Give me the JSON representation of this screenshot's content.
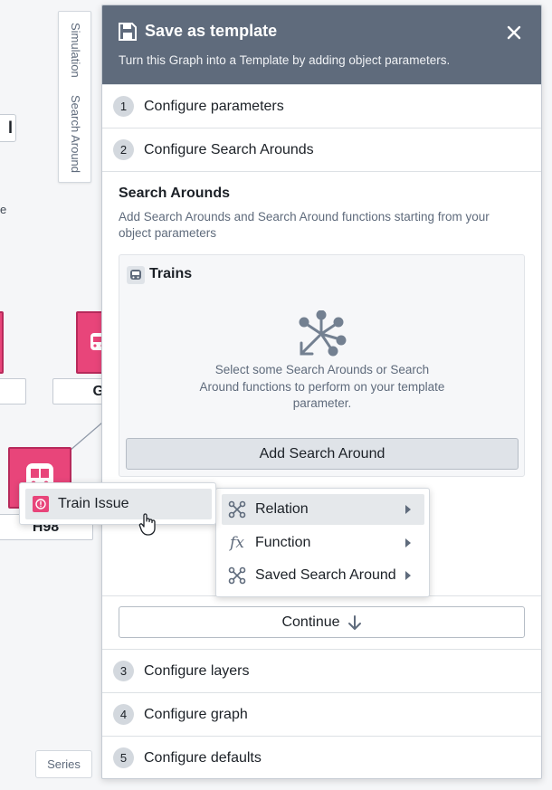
{
  "canvas": {
    "vertical_tabs": [
      "Simulation",
      "Search Around"
    ],
    "clipped_chip_text": "l",
    "clipped_text": "e",
    "node_labels": [
      "G",
      "H98"
    ],
    "series_button": "Series"
  },
  "panel": {
    "title": "Save as template",
    "subtitle": "Turn this Graph into a Template by adding object parameters.",
    "steps": [
      {
        "num": "1",
        "label": "Configure parameters"
      },
      {
        "num": "2",
        "label": "Configure Search Arounds"
      },
      {
        "num": "3",
        "label": "Configure layers"
      },
      {
        "num": "4",
        "label": "Configure graph"
      },
      {
        "num": "5",
        "label": "Configure defaults"
      }
    ],
    "section": {
      "title": "Search Arounds",
      "description": "Add Search Arounds and Search Around functions starting from your object parameters"
    },
    "card": {
      "title": "Trains",
      "empty_text": "Select some Search Arounds or Search Around functions to perform on your template parameter.",
      "add_button": "Add Search Around"
    },
    "continue_button": "Continue"
  },
  "menu": {
    "items": [
      {
        "label": "Relation",
        "icon": "relation-icon"
      },
      {
        "label": "Function",
        "icon": "function-icon"
      },
      {
        "label": "Saved Search Around",
        "icon": "search-around-icon"
      }
    ]
  },
  "popover": {
    "item": "Train Issue"
  },
  "colors": {
    "header_bg": "#5f6b7c",
    "node_pink": "#e8457a",
    "node_border": "#b72a5b"
  }
}
